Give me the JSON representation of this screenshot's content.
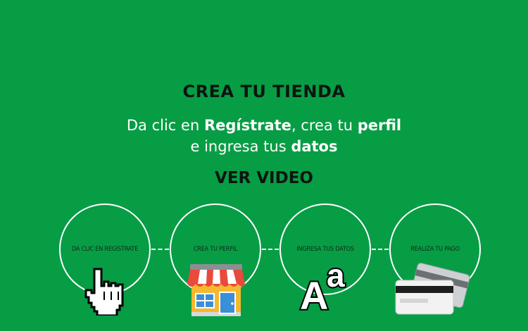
{
  "hero": {
    "title": "CREA TU TIENDA",
    "subtitle_line1_a": "Da clic en ",
    "subtitle_line1_b": "Regístrate",
    "subtitle_line1_c": ", crea tu ",
    "subtitle_line1_d": "perfil",
    "subtitle_line2_a": "e ingresa tus ",
    "subtitle_line2_b": "datos",
    "video_link": "VER VIDEO"
  },
  "steps": [
    {
      "label": "Da clic en Regístrate",
      "icon": "hand-pointer-icon"
    },
    {
      "label": "Crea tu perfil",
      "icon": "store-icon"
    },
    {
      "label": "Ingresa tus datos",
      "icon": "font-size-icon"
    },
    {
      "label": "Realiza tu pago",
      "icon": "credit-cards-icon"
    }
  ],
  "icons": {
    "font_big": "A",
    "font_small": "a"
  },
  "colors": {
    "background": "#079d45",
    "title": "#0d1510",
    "text": "#ffffff",
    "step_label": "#0f2a18"
  }
}
